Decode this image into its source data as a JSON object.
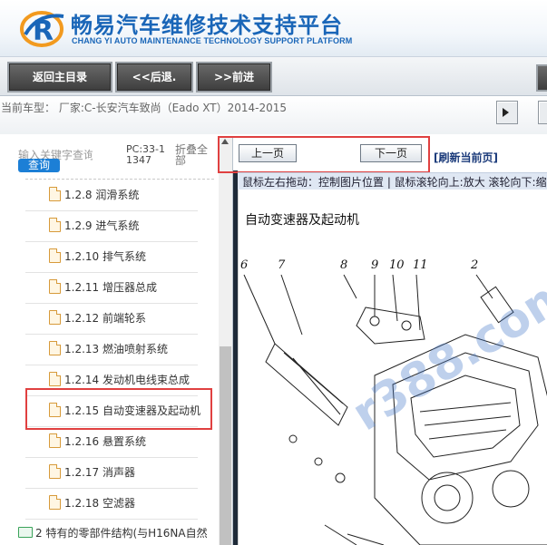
{
  "header": {
    "title": "畅易汽车维修技术支持平台",
    "subtitle": "CHANG YI AUTO MAINTENANCE TECHNOLOGY SUPPORT PLATFORM",
    "logo_letter": "R"
  },
  "toolbar": {
    "home_label": "返回主目录",
    "back_label": "<<后退.",
    "forward_label": ">>前进"
  },
  "model_bar": {
    "text": "当前车型： 厂家:C-长安汽车致尚（Eado XT）2014-2015"
  },
  "sidebar": {
    "search_placeholder": "输入关键字查询",
    "search_button": "查询",
    "pc_code": "PC:33-11347",
    "collapse_all": "折叠全部",
    "items": [
      {
        "label": "1.2.8 润滑系统"
      },
      {
        "label": "1.2.9 进气系统"
      },
      {
        "label": "1.2.10 排气系统"
      },
      {
        "label": "1.2.11 增压器总成"
      },
      {
        "label": "1.2.12 前端轮系"
      },
      {
        "label": "1.2.13 燃油喷射系统"
      },
      {
        "label": "1.2.14 发动机电线束总成"
      },
      {
        "label": "1.2.15 自动变速器及起动机"
      },
      {
        "label": "1.2.16 悬置系统"
      },
      {
        "label": "1.2.17 消声器"
      },
      {
        "label": "1.2.18 空滤器"
      }
    ],
    "folder_label": "2 特有的零部件结构(与H16NA自然"
  },
  "viewer": {
    "prev_page": "上一页",
    "next_page": "下一页",
    "refresh": "[刷新当前页]",
    "hint": "鼠标左右拖动：控制图片位置 | 鼠标滚轮向上:放大  滚轮向下:缩",
    "doc_title": "自动变速器及起动机",
    "callouts": [
      "6",
      "7",
      "8",
      "9",
      "10",
      "11",
      "2"
    ],
    "watermark": "r388.com"
  },
  "colors": {
    "brand_blue": "#1a66b8",
    "highlight_red": "#e04040",
    "search_blue": "#1c7fd6"
  }
}
